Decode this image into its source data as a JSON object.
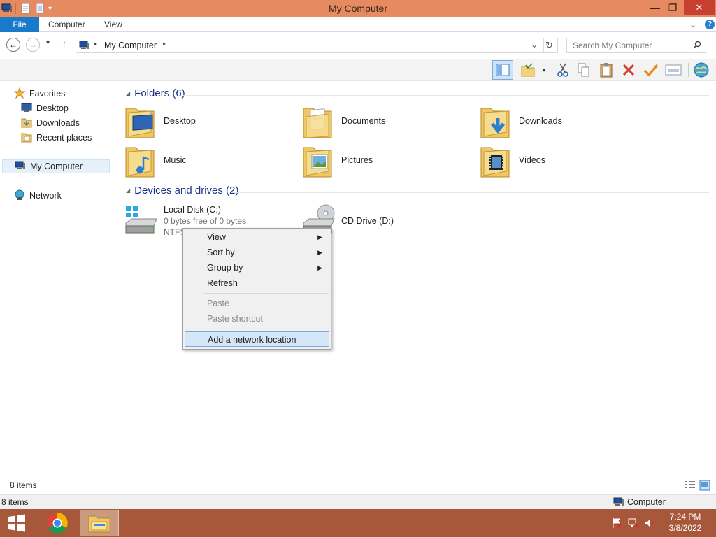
{
  "window": {
    "title": "My Computer",
    "min_glyph": "—",
    "max_glyph": "❐",
    "close_glyph": "✕"
  },
  "ribbon": {
    "tabs": [
      "File",
      "Computer",
      "View"
    ],
    "expand_glyph": "⌄",
    "help_glyph": "?"
  },
  "addressbar": {
    "back": "←",
    "forward": "→",
    "recent": "▾",
    "up": "↑",
    "location": "My Computer",
    "crumb_sep": "▸",
    "dropdown": "⌄",
    "refresh": "↻",
    "search_placeholder": "Search My Computer"
  },
  "navpane": {
    "favorites": "Favorites",
    "desktop": "Desktop",
    "downloads": "Downloads",
    "recent_places": "Recent places",
    "my_computer": "My Computer",
    "network": "Network"
  },
  "content": {
    "folders_header": "Folders (6)",
    "folders": [
      "Desktop",
      "Documents",
      "Downloads",
      "Music",
      "Pictures",
      "Videos"
    ],
    "devices_header": "Devices and drives (2)",
    "local_disk": {
      "name": "Local Disk (C:)",
      "free": "0 bytes free of 0 bytes",
      "fs": "NTFS"
    },
    "cd_drive": "CD Drive (D:)"
  },
  "context_menu": {
    "items": [
      "View",
      "Sort by",
      "Group by",
      "Refresh",
      "Paste",
      "Paste shortcut",
      "Add a network location"
    ],
    "submenu_arrow": "▶"
  },
  "status": {
    "items_count": "8 items",
    "items_count_bottom": "8 items",
    "location": "Computer"
  },
  "taskbar": {
    "time": "7:24 PM",
    "date": "3/8/2022"
  },
  "colors": {
    "titlebar": "#e68b61",
    "file_tab": "#1979ca",
    "taskbar": "#a8583a",
    "group_header": "#1e3287",
    "menu_highlight": "#d5e6f8"
  }
}
